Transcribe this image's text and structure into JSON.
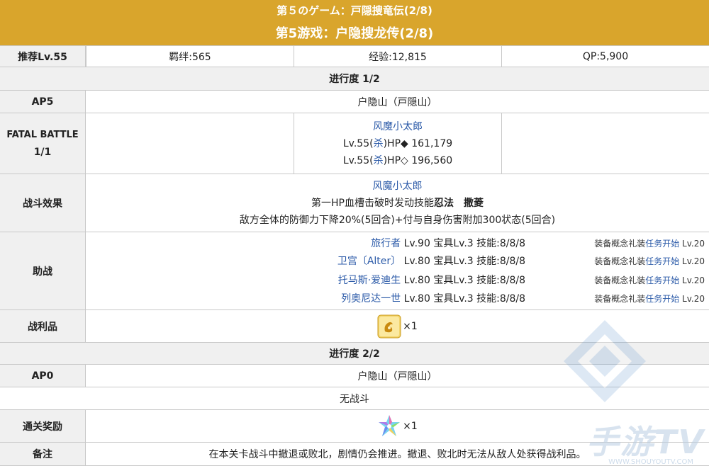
{
  "header": {
    "title_jp": "第５のゲーム：戸隠捜竜伝(2/8)",
    "title_cn": "第5游戏：户隐搜龙传(2/8)"
  },
  "summary": {
    "recommend": "推荐Lv.55",
    "bond": "羁绊:565",
    "exp": "经验:12,815",
    "qp": "QP:5,900"
  },
  "progress1": {
    "title": "进行度 1/2",
    "ap_label": "AP5",
    "location": "户隐山（戸隠山）",
    "fatal_label_1": "FATAL BATTLE",
    "fatal_label_2": "1/1",
    "enemy_name": "风魔小太郎",
    "enemy_hp1_prefix": "Lv.55(",
    "enemy_class": "杀",
    "enemy_hp1_suffix": ")HP◆ 161,179",
    "enemy_hp2_suffix": ")HP◇ 196,560",
    "effect_label": "战斗效果",
    "effect_name": "风魔小太郎",
    "effect_line1_a": "第一HP血槽击破时发动技能",
    "effect_line1_b": "忍法　撒菱",
    "effect_line2": "敌方全体的防御力下降20%(5回合)+付与自身伤害附加300状态(5回合)",
    "support_label": "助战",
    "supports": [
      {
        "name": "旅行者",
        "info": " Lv.90 宝具Lv.3 技能:8/8/8",
        "ce_a": "装备概念礼装",
        "ce_b": "任务开始",
        "ce_c": " Lv.20"
      },
      {
        "name": "卫宫〔Alter〕",
        "info": " Lv.80 宝具Lv.3 技能:8/8/8",
        "ce_a": "装备概念礼装",
        "ce_b": "任务开始",
        "ce_c": " Lv.20"
      },
      {
        "name": "托马斯·爱迪生",
        "info": " Lv.80 宝具Lv.3 技能:8/8/8",
        "ce_a": "装备概念礼装",
        "ce_b": "任务开始",
        "ce_c": " Lv.20"
      },
      {
        "name": "列奥尼达一世",
        "info": " Lv.80 宝具Lv.3 技能:8/8/8",
        "ce_a": "装备概念礼装",
        "ce_b": "任务开始",
        "ce_c": " Lv.20"
      }
    ],
    "drop_label": "战利品",
    "drop_qty": "×1"
  },
  "progress2": {
    "title": "进行度 2/2",
    "ap_label": "AP0",
    "location": "户隐山（戸隠山）",
    "no_battle": "无战斗"
  },
  "reward": {
    "label": "通关奖励",
    "qty": "×1"
  },
  "notes": {
    "label": "备注",
    "text": "在本关卡战斗中撤退或败北，剧情仍会推进。撤退、败北时无法从敌人处获得战利品。"
  },
  "watermark": {
    "text": "手游TV",
    "url": "WWW.SHOUYOUTV.COM"
  },
  "colors": {
    "header_bg": "#d9a52c",
    "label_bg": "#f0f0f0",
    "link_blue": "#2b5aa8"
  }
}
